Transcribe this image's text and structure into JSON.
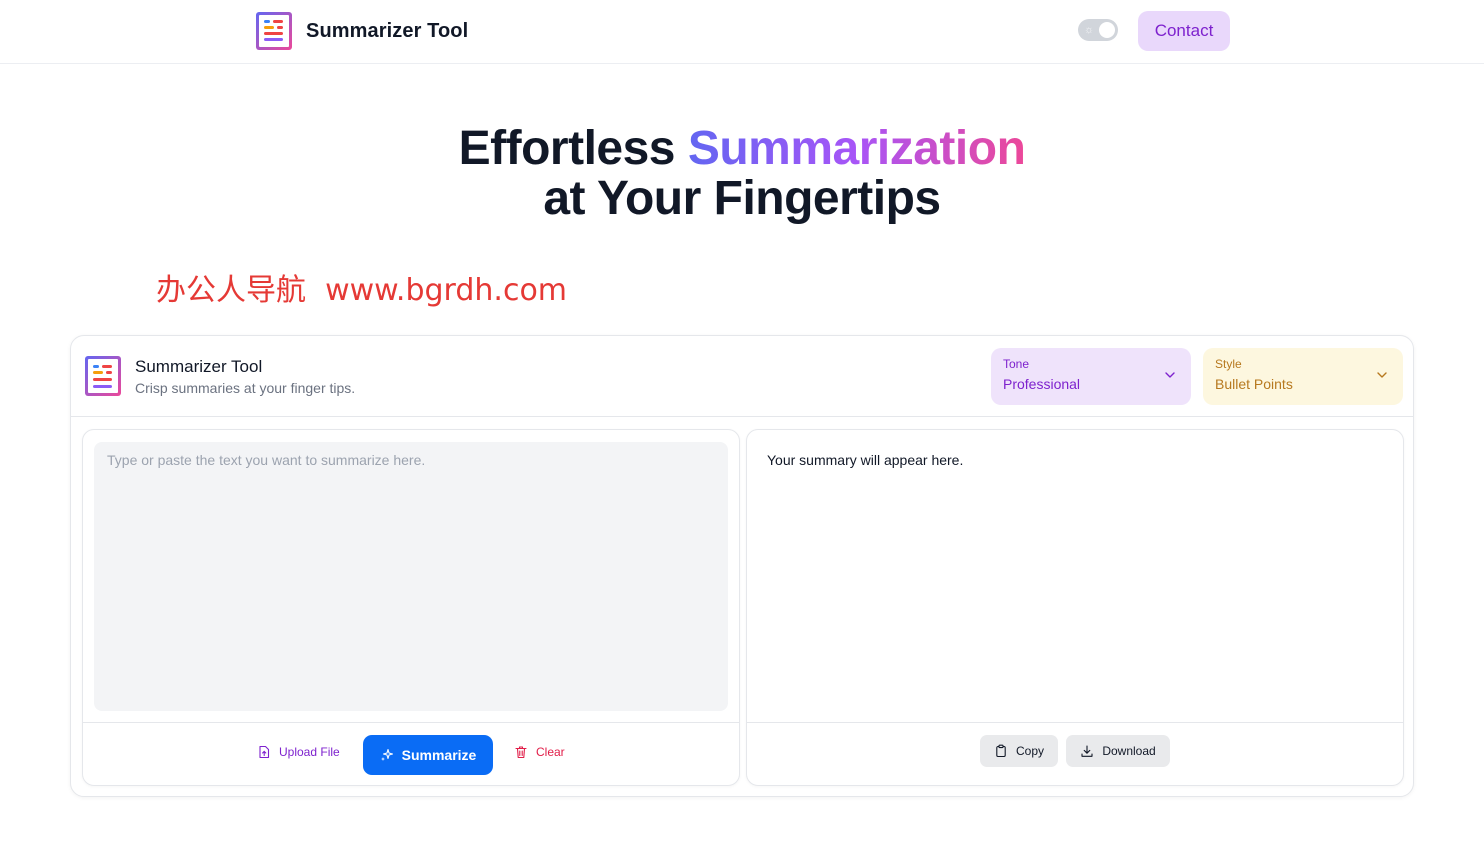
{
  "nav": {
    "brand_title": "Summarizer Tool",
    "theme_toggle_icon": "sun-icon",
    "contact_label": "Contact"
  },
  "hero": {
    "line1_plain": "Effortless ",
    "line1_accent": "Summarization",
    "line2": "at Your Fingertips"
  },
  "watermark": "办公人导航  www.bgrdh.com",
  "card": {
    "title": "Summarizer Tool",
    "subtitle": "Crisp summaries at your finger tips.",
    "tone": {
      "label": "Tone",
      "value": "Professional"
    },
    "style": {
      "label": "Style",
      "value": "Bullet Points"
    }
  },
  "input_panel": {
    "placeholder": "Type or paste the text you want to summarize here.",
    "value": "",
    "upload_label": "Upload File",
    "summarize_label": "Summarize",
    "clear_label": "Clear"
  },
  "output_panel": {
    "summary_text": "Your summary will appear here.",
    "copy_label": "Copy",
    "download_label": "Download"
  },
  "colors": {
    "primary_blue": "#0a6cf5",
    "purple_accent": "#7e22ce",
    "tone_bg": "#efe3fb",
    "style_bg": "#fdf7df",
    "style_text": "#b7791f",
    "clear_red": "#e11d48",
    "gradient_start": "#6366f1",
    "gradient_end": "#ec4899"
  },
  "icons": [
    "logo-icon",
    "sun-icon",
    "chevron-down-icon",
    "file-upload-icon",
    "sparkles-icon",
    "trash-icon",
    "clipboard-icon",
    "download-icon"
  ]
}
